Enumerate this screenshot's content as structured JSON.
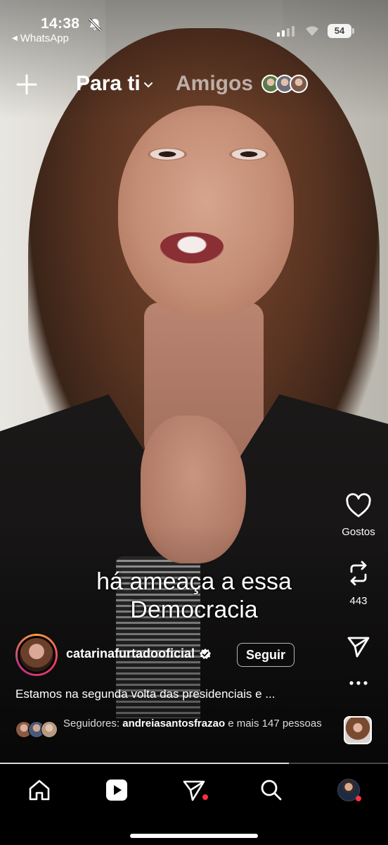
{
  "status_bar": {
    "time": "14:38",
    "back_app": "WhatsApp",
    "battery": "54"
  },
  "top_tabs": {
    "active": "Para ti",
    "inactive": "Amigos",
    "friend_avatar_colors": [
      "#5a7a4a",
      "#6a6f7a",
      "#7a5a4a"
    ]
  },
  "video": {
    "caption": "há ameaça a essa Democracia",
    "progress_fraction": 0.745
  },
  "actions": {
    "like_label": "Gostos",
    "repost_count": "443"
  },
  "post": {
    "username": "catarinafurtadooficial",
    "verified": true,
    "follow_label": "Seguir",
    "description": "Estamos na segunda volta das presidenciais e ...",
    "followers_prefix": "Seguidores: ",
    "followers_name": "andreiasantosfrazao",
    "followers_suffix": " e mais 147 pessoas"
  },
  "bottom_nav": {
    "items": [
      "home-icon",
      "reels-icon",
      "direct-messages-icon",
      "search-icon",
      "profile-avatar"
    ],
    "notification_dot_color": "#ff3040"
  },
  "colors": {
    "story_ring": [
      "#f9a03f",
      "#e23a63",
      "#c13584"
    ],
    "background": "#000000"
  }
}
